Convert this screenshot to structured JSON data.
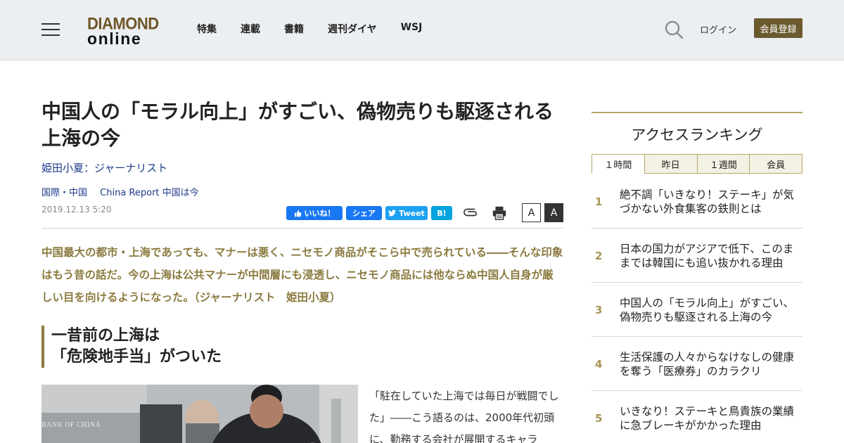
{
  "header": {
    "logo_top": "DIAMOND",
    "logo_bottom": "online",
    "nav": [
      "特集",
      "連載",
      "書籍",
      "週刊ダイヤ",
      "WSJ"
    ],
    "login_label": "ログイン",
    "register_label": "会員登録",
    "search_icon": "search-icon",
    "menu_icon": "hamburger-menu-icon",
    "accent_color": "#6b5a2e"
  },
  "article": {
    "title": "中国人の「モラル向上」がすごい、偽物売りも駆逐される上海の今",
    "author": "姫田小夏：ジャーナリスト",
    "categories": [
      "国際・中国",
      "China Report 中国は今"
    ],
    "date": "2019.12.13 5:20",
    "share": {
      "like": "いいね！",
      "share": "シェア",
      "tweet": "Tweet",
      "hatena": "B!"
    },
    "tools": {
      "clip_icon": "paperclip-icon",
      "print_icon": "printer-icon",
      "font_small": "A",
      "font_large": "A"
    },
    "lead": "中国最大の都市・上海であっても、マナーは悪く、ニセモノ商品がそこら中で売られている――そんな印象はもう昔の話だ。今の上海は公共マナーが中間層にも浸透し、ニセモノ商品には他ならぬ中国人自身が厳しい目を向けるようになった。（ジャーナリスト　姫田小夏）",
    "subhead_line1": "一昔前の上海は",
    "subhead_line2": "「危険地手当」がついた",
    "photo_sign": "BANK OF CHINA",
    "body": "「駐在していた上海では毎日が戦闘でした」――こう語るのは、2000年代初頭に、勤務する会社が展開するキャラ"
  },
  "ranking": {
    "title": "アクセスランキング",
    "tabs": [
      "１時間",
      "昨日",
      "１週間",
      "会員"
    ],
    "items": [
      {
        "num": "1",
        "text": "絶不調「いきなり！ステーキ」が気づかない外食集客の鉄則とは"
      },
      {
        "num": "2",
        "text": "日本の国力がアジアで低下、このままでは韓国にも追い抜かれる理由"
      },
      {
        "num": "3",
        "text": "中国人の「モラル向上」がすごい、偽物売りも駆逐される上海の今"
      },
      {
        "num": "4",
        "text": "生活保護の人々からなけなしの健康を奪う「医療券」のカラクリ"
      },
      {
        "num": "5",
        "text": "いきなり！ステーキと鳥貴族の業績に急ブレーキがかかった理由"
      }
    ]
  }
}
